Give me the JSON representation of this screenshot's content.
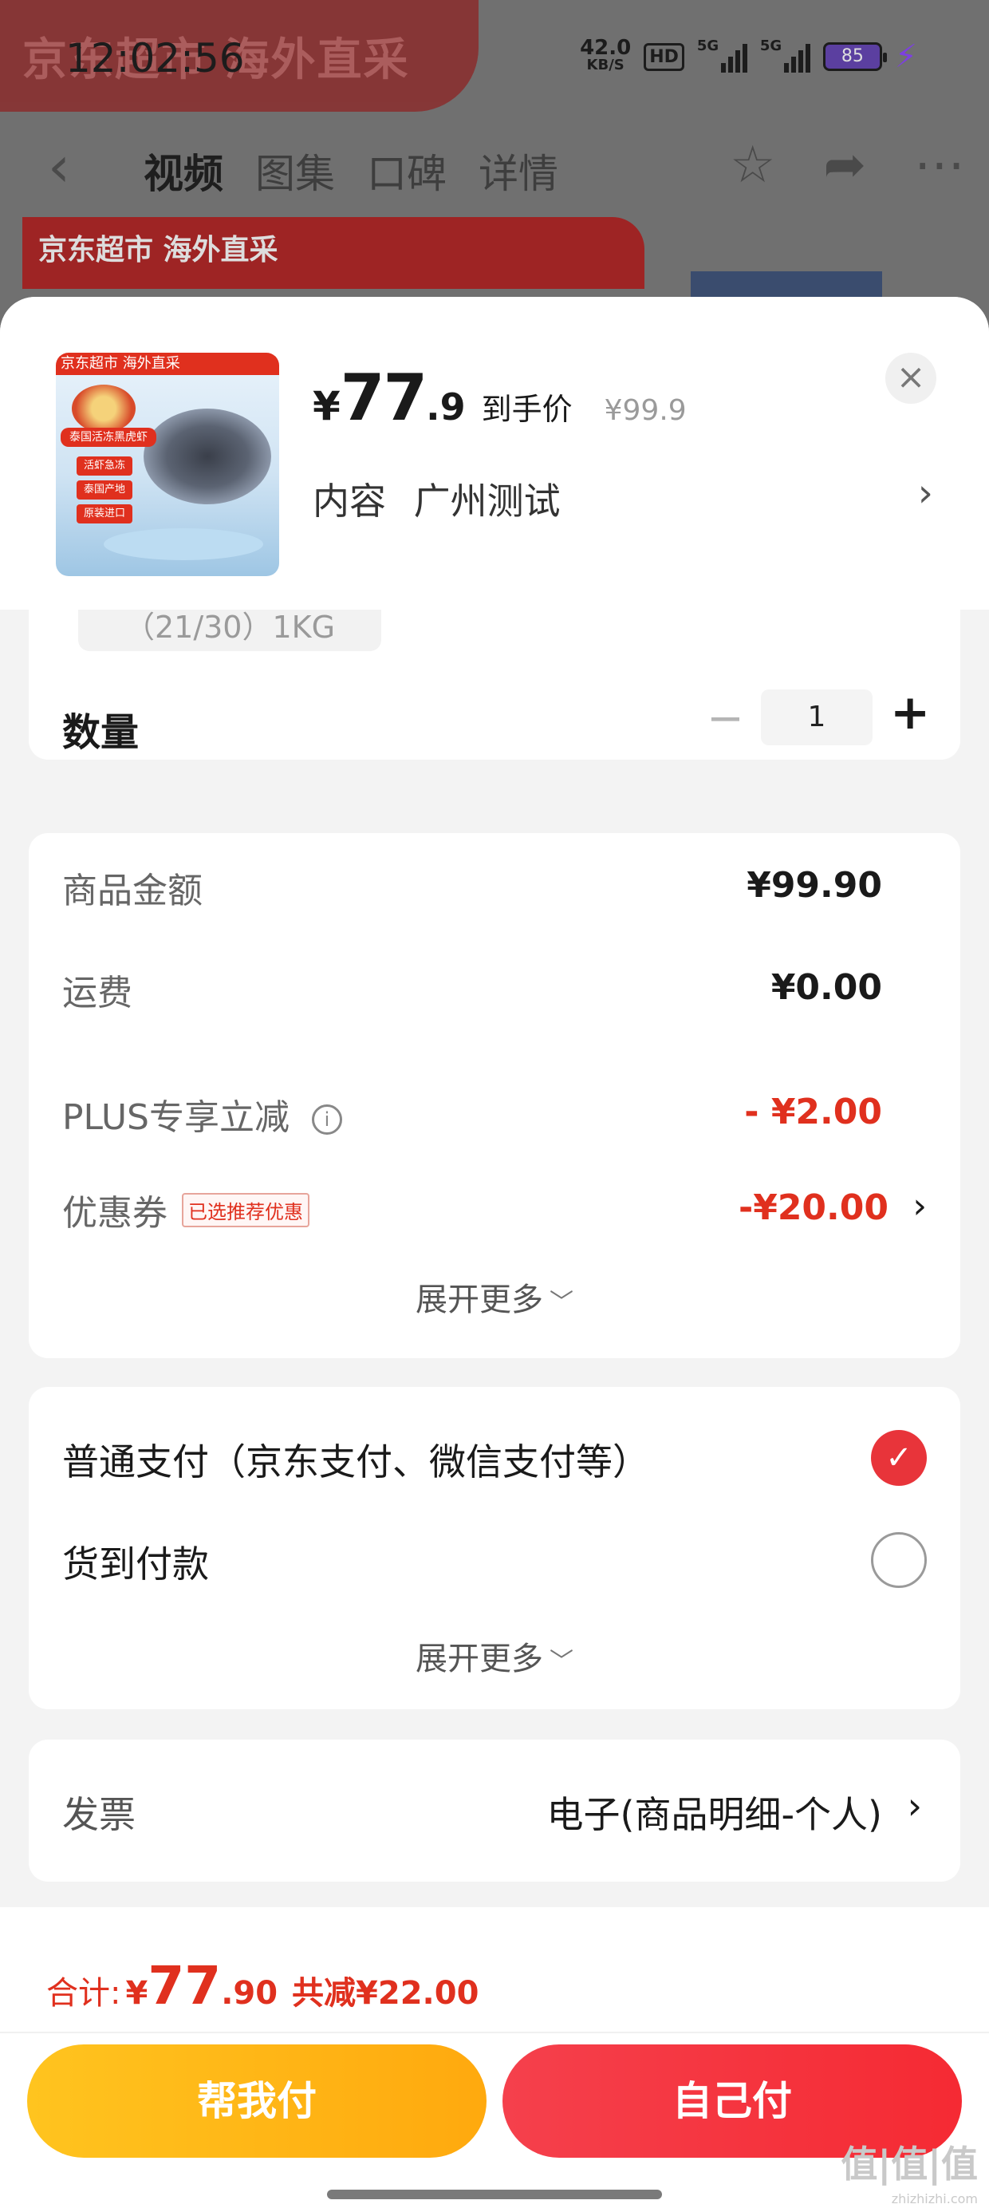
{
  "status_bar": {
    "time": "12:02:56",
    "net_speed_value": "42.0",
    "net_speed_unit": "KB/S",
    "hd_label": "HD",
    "signal1_label": "5G",
    "signal2_label": "5G",
    "battery_level": "85"
  },
  "background_page": {
    "banner_text": "京东超市 海外直采",
    "tabs": [
      {
        "label": "视频",
        "active": true
      },
      {
        "label": "图集",
        "active": false
      },
      {
        "label": "口碑",
        "active": false
      },
      {
        "label": "详情",
        "active": false
      }
    ],
    "badge_text": "京东超市 海外直采"
  },
  "product": {
    "thumb_header": "京东超市 海外直采",
    "thumb_title": "泰国活冻黑虎虾",
    "thumb_tags": [
      "活虾急冻",
      "泰国产地",
      "原装进口"
    ],
    "price_yen": "¥",
    "price_int": "77",
    "price_dec": ".9",
    "price_label": "到手价",
    "original_price": "¥99.9",
    "spec_prefix": "内容",
    "spec_value": "广州测试",
    "close_symbol": "×"
  },
  "sku": {
    "chip_text": "（21/30）1KG",
    "quantity_label": "数量",
    "quantity_value": "1",
    "minus_symbol": "−",
    "plus_symbol": "+"
  },
  "amounts": {
    "goods_label": "商品金额",
    "goods_value": "¥99.90",
    "shipping_label": "运费",
    "shipping_value": "¥0.00",
    "plus_label": "PLUS专享立减",
    "plus_value": "- ¥2.00",
    "coupon_label": "优惠券",
    "coupon_tag": "已选推荐优惠",
    "coupon_value": "-¥20.00",
    "expand_label": "展开更多"
  },
  "payment": {
    "options": [
      {
        "label": "普通支付（京东支付、微信支付等）",
        "selected": true
      },
      {
        "label": "货到付款",
        "selected": false
      }
    ],
    "expand_label": "展开更多"
  },
  "invoice": {
    "label": "发票",
    "value": "电子(商品明细-个人)"
  },
  "footer": {
    "total_label": "合计:",
    "total_yen": "¥",
    "total_int": "77",
    "total_dec": ".90",
    "saved_text": "共减¥22.00",
    "helper_button": "帮我付",
    "self_button": "自己付"
  },
  "watermark": {
    "text": "值|值|值",
    "site": "zhizhizhi.com"
  },
  "colors": {
    "accent_red": "#e0301e",
    "pay_red": "#f52a33",
    "helper_orange": "#ffa90e"
  }
}
